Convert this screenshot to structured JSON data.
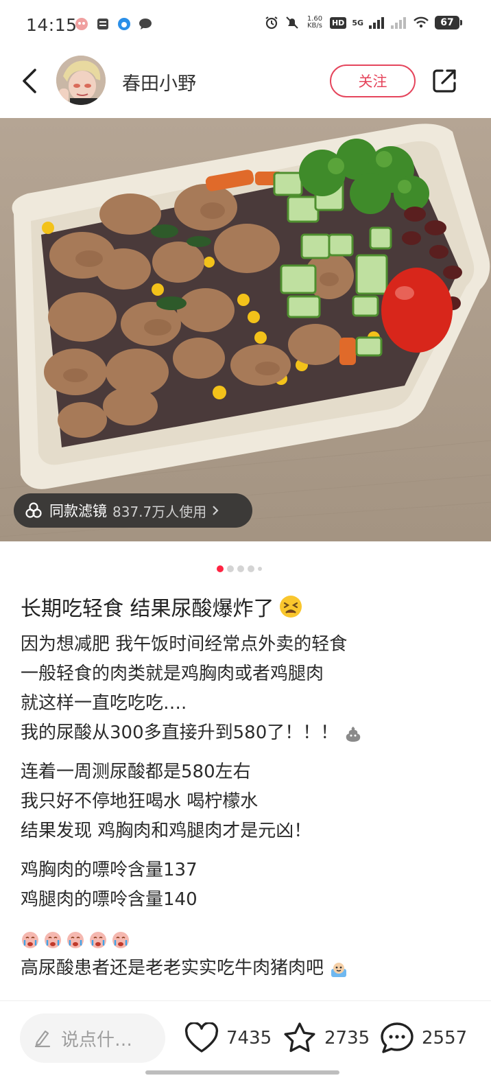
{
  "status_bar": {
    "time": "14:15",
    "net_speed_value": "1.60",
    "net_speed_unit": "KB/s",
    "hd_label": "HD",
    "network_label": "5G",
    "battery": "67"
  },
  "header": {
    "author_name": "春田小野",
    "follow_label": "关注"
  },
  "photo": {
    "filter_chip": {
      "title": "同款滤镜",
      "users": "837.7万人使用"
    }
  },
  "carousel": {
    "total": 5,
    "active_index": 0
  },
  "post": {
    "title": "长期吃轻食 结果尿酸爆炸了",
    "title_emoji": "distressed-face-emoji",
    "paragraphs": [
      {
        "lines": [
          "因为想减肥 我午饭时间经常点外卖的轻食",
          "一般轻食的肉类就是鸡胸肉或者鸡腿肉",
          "就这样一直吃吃吃…."
        ]
      },
      {
        "lines": [
          "我的尿酸从300多直接升到580了！！！"
        ],
        "trailing_emoji": "poop-emoji"
      },
      {
        "lines": [
          "连着一周测尿酸都是580左右",
          "我只好不停地狂喝水 喝柠檬水",
          "结果发现 鸡胸肉和鸡腿肉才是元凶！"
        ]
      },
      {
        "lines": [
          "鸡胸肉的嘌呤含量137",
          "鸡腿肉的嘌呤含量140"
        ]
      },
      {
        "emoji_row": "crying-face-emoji",
        "emoji_count": 5
      },
      {
        "lines": [
          "高尿酸患者还是老老实实吃牛肉猪肉吧"
        ],
        "trailing_emoji": "sweating-face-emoji"
      }
    ]
  },
  "bottom_bar": {
    "comment_placeholder": "说点什…",
    "likes": "7435",
    "collects": "2735",
    "comments": "2557"
  },
  "colors": {
    "accent": "#ff2442",
    "follow_border": "#e5455c"
  }
}
